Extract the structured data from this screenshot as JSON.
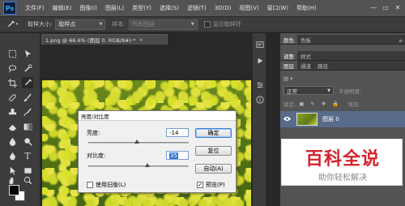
{
  "app": {
    "logo": "Ps"
  },
  "menubar": {
    "items": [
      "文件(F)",
      "编辑(E)",
      "图像(I)",
      "图层(L)",
      "类型(Y)",
      "选择(S)",
      "滤镜(T)",
      "3D(D)",
      "视图(V)",
      "窗口(W)",
      "帮助(H)"
    ],
    "window_buttons": [
      "—",
      "▭",
      "✕"
    ]
  },
  "options": {
    "tool_icon": "eyedropper-icon",
    "sample_size_label": "取样大小:",
    "sample_size_value": "取样点",
    "sample_label": "样本:",
    "sample_value": "所有图层",
    "show_ring_label": "显示取样环"
  },
  "document": {
    "tab_title": "1.png @ 66.6% (图层 0, RGB/8#) *",
    "close": "×"
  },
  "dialog": {
    "title": "亮度/对比度",
    "brightness_label": "亮度:",
    "brightness_value": "-14",
    "brightness_slider": 0.48,
    "contrast_label": "对比度:",
    "contrast_value": "35",
    "contrast_slider": 0.59,
    "ok_label": "确定",
    "reset_label": "复位",
    "auto_label": "自动(A)",
    "legacy_label": "使用旧版(L)",
    "legacy_checked": false,
    "preview_label": "预览(P)",
    "preview_checked": true
  },
  "panels": {
    "top_tabs": [
      "颜色",
      "色板"
    ],
    "mid_tabs": [
      "调整",
      "样式"
    ],
    "layer_tabs": [
      "图层",
      "通道",
      "路径"
    ],
    "blend_mode": "正常",
    "opacity_label": "不透明度:",
    "lock_label": "锁定:",
    "fill_label": "填充:",
    "layer_name": "图层 0"
  },
  "watermark": {
    "title": "百科全说",
    "subtitle": "助你轻松解决"
  },
  "colors": {
    "accent": "#31a8ff",
    "watermark_red": "#d3242f",
    "layer_selected": "#596b8a"
  }
}
